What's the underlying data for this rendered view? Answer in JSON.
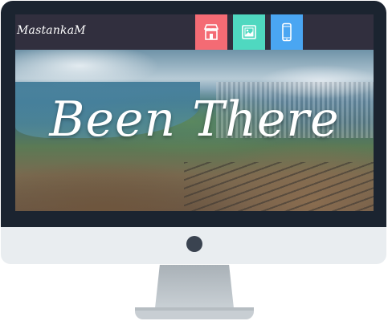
{
  "site": {
    "logo": "MastankaM",
    "hero_title": "Been There"
  },
  "nav": [
    {
      "icon": "store-icon",
      "color": "#f46b74"
    },
    {
      "icon": "image-icon",
      "color": "#4fd8c0"
    },
    {
      "icon": "mobile-icon",
      "color": "#4aa6f2"
    }
  ],
  "colors": {
    "bezel": "#1b2430",
    "topbar": "#312f3e",
    "chin": "#e9edf0"
  }
}
